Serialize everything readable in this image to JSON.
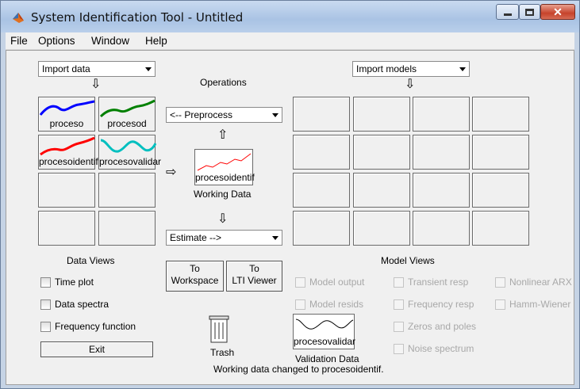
{
  "window": {
    "title": "System Identification Tool - Untitled",
    "icon": "matlab-logo-icon"
  },
  "menu": [
    "File",
    "Options",
    "Window",
    "Help"
  ],
  "import_data": {
    "label": "Import data"
  },
  "import_models": {
    "label": "Import models"
  },
  "operations": {
    "label": "Operations",
    "preprocess": "<-- Preprocess",
    "estimate": "Estimate -->",
    "working_data_name": "procesoidentif",
    "working_data_caption": "Working Data",
    "to_workspace": [
      "To",
      "Workspace"
    ],
    "to_lti_viewer": [
      "To",
      "LTI Viewer"
    ]
  },
  "data_slots": [
    {
      "name": "proceso",
      "color": "#0000ff"
    },
    {
      "name": "procesod",
      "color": "#008000"
    },
    {
      "name": "procesoidentif",
      "color": "#ff0000"
    },
    {
      "name": "procesovalidar",
      "color": "#00bfbf"
    }
  ],
  "data_views": {
    "title": "Data Views",
    "items": [
      "Time plot",
      "Data spectra",
      "Frequency function"
    ],
    "exit": "Exit"
  },
  "model_views": {
    "title": "Model Views",
    "col1": [
      "Model output",
      "Model resids"
    ],
    "col2": [
      "Transient resp",
      "Frequency resp",
      "Zeros and poles",
      "Noise spectrum"
    ],
    "col3": [
      "Nonlinear ARX",
      "Hamm-Wiener"
    ]
  },
  "trash": {
    "label": "Trash"
  },
  "validation": {
    "name": "procesovalidar",
    "caption": "Validation Data"
  },
  "status": "Working data changed to procesoidentif."
}
